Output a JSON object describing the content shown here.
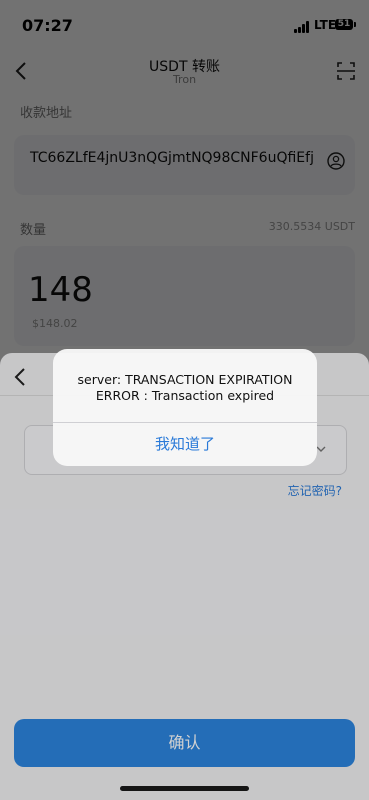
{
  "status_bar": {
    "time": "07:27",
    "network": "LTE",
    "battery": "51"
  },
  "header": {
    "title": "USDT 转账",
    "subtitle": "Tron",
    "back_icon": "chevron-left-icon",
    "scan_icon": "scan-icon"
  },
  "address_section": {
    "label": "收款地址",
    "value": "TC66ZLfE4jnU3nQGjmtNQ98CNF6uQfiEfj",
    "contact_icon": "person-icon"
  },
  "amount_section": {
    "label": "数量",
    "balance": "330.5534 USDT",
    "value": "148",
    "usd_value": "$148.02"
  },
  "password_sheet": {
    "back_icon": "chevron-left-icon",
    "forgot_link": "忘记密码?"
  },
  "confirm_button": {
    "label": "确认"
  },
  "alert": {
    "line1": "server:  TRANSACTION EXPIRATION",
    "line2": "ERROR : Transaction expired",
    "button": "我知道了"
  },
  "colors": {
    "accent": "#2d86e0",
    "link": "#2a7ad8"
  }
}
